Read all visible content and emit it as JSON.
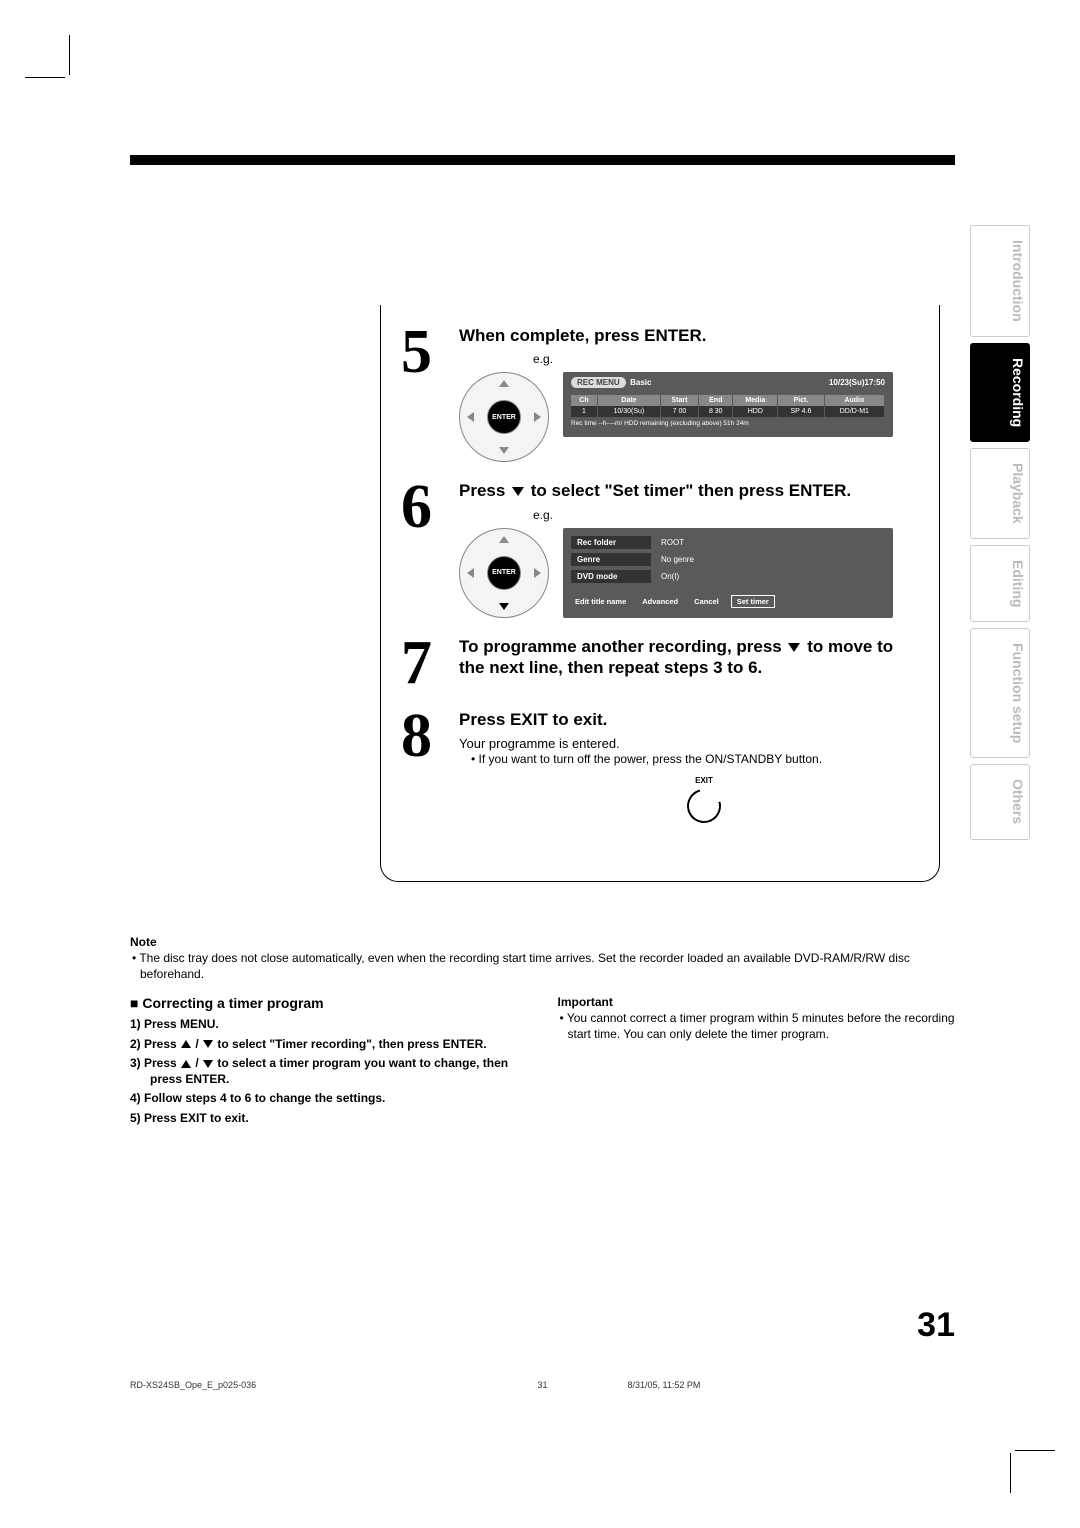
{
  "page_number": "31",
  "sidetabs": [
    "Introduction",
    "Recording",
    "Playback",
    "Editing",
    "Function setup",
    "Others"
  ],
  "active_tab_index": 1,
  "steps": {
    "s5": {
      "num": "5",
      "title": "When complete, press ENTER.",
      "eg": "e.g.",
      "osd": {
        "menu": "REC MENU",
        "mode": "Basic",
        "datetime": "10/23(Su)17:50",
        "headers": [
          "Ch",
          "Date",
          "Start",
          "End",
          "Media",
          "Pict.",
          "Audio"
        ],
        "row": [
          "1",
          "10/30(Su)",
          "7   00",
          "8   30",
          "HDD",
          "SP  4.6",
          "DD/D-M1"
        ],
        "foot": "Rec time --h----m/ HDD remaining (excluding above)   51h 24m"
      }
    },
    "s6": {
      "num": "6",
      "title_a": "Press ",
      "title_b": " to select \"Set timer\" then press ENTER.",
      "eg": "e.g.",
      "osd": {
        "rows": [
          {
            "label": "Rec folder",
            "val": "ROOT"
          },
          {
            "label": "Genre",
            "val": "No genre"
          },
          {
            "label": "DVD mode",
            "val": "On(I)"
          }
        ],
        "buttons": [
          "Edit title name",
          "Advanced",
          "Cancel",
          "Set timer"
        ],
        "selected": 3
      }
    },
    "s7": {
      "num": "7",
      "title_a": "To programme another recording, press ",
      "title_b": " to move to the next line, then repeat steps 3 to 6."
    },
    "s8": {
      "num": "8",
      "title": "Press EXIT to exit.",
      "line1": "Your programme is entered.",
      "bullet": "If you want to turn off the power, press the ON/STANDBY button.",
      "exit_label": "EXIT"
    }
  },
  "note": {
    "heading": "Note",
    "body": "• The disc tray does not close automatically, even when the recording start time arrives. Set the recorder loaded an available DVD-RAM/R/RW disc beforehand."
  },
  "correcting": {
    "heading": "Correcting a timer program",
    "items": {
      "i1": "1) Press MENU.",
      "i2a": "2) Press ",
      "i2b": " to select \"Timer recording\", then press ENTER.",
      "i3a": "3) Press ",
      "i3b": " to select a timer program you want to change, then press ENTER.",
      "i4": "4) Follow steps 4 to 6 to change the settings.",
      "i5": "5) Press EXIT to exit."
    },
    "important_h": "Important",
    "important_b": "• You cannot correct a timer program within 5 minutes before the recording start time. You can only delete the timer program."
  },
  "footer": {
    "left": "RD-XS24SB_Ope_E_p025-036",
    "center": "31",
    "right": "8/31/05, 11:52 PM"
  },
  "enter_label": "ENTER"
}
